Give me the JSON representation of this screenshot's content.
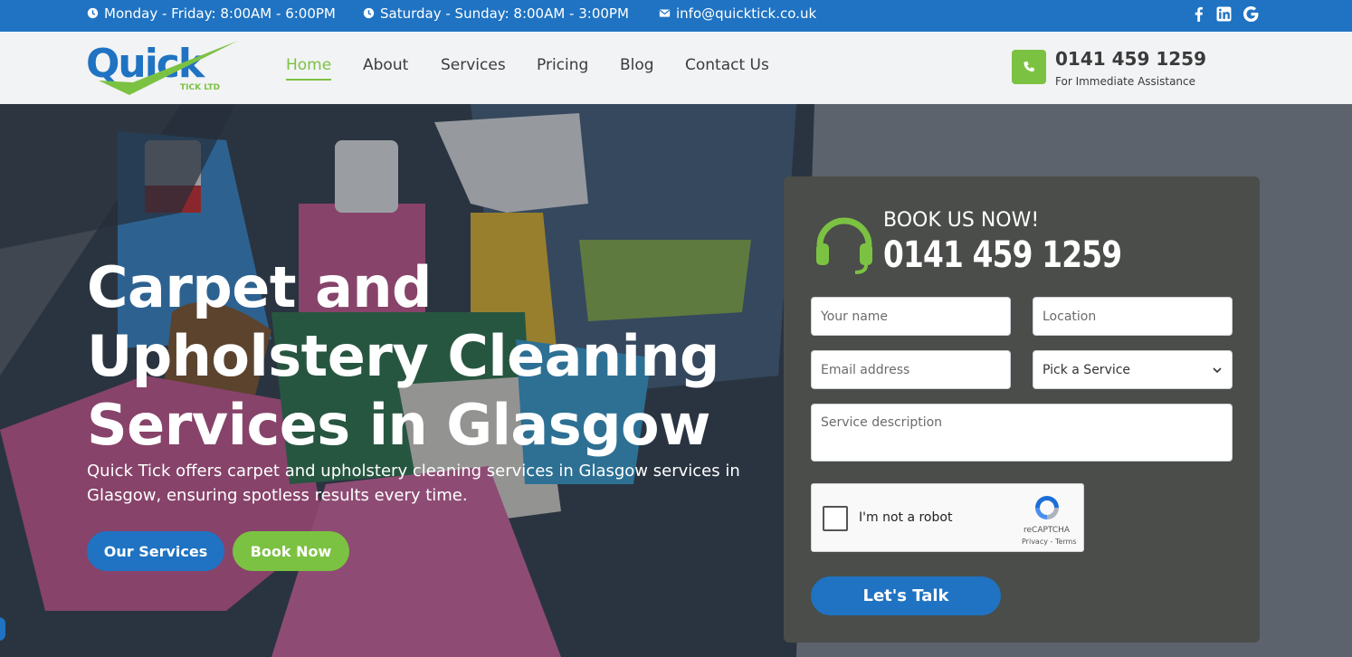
{
  "topbar": {
    "hours_weekday": "Monday - Friday: 8:00AM - 6:00PM",
    "hours_weekend": "Saturday - Sunday: 8:00AM - 3:00PM",
    "email": "info@quicktick.co.uk",
    "social_icons": [
      "facebook-icon",
      "linkedin-icon",
      "google-icon"
    ]
  },
  "header": {
    "logo_text": "Quick",
    "logo_sub": "TICK LTD",
    "nav": [
      {
        "label": "Home",
        "active": true
      },
      {
        "label": "About",
        "active": false
      },
      {
        "label": "Services",
        "active": false
      },
      {
        "label": "Pricing",
        "active": false
      },
      {
        "label": "Blog",
        "active": false
      },
      {
        "label": "Contact Us",
        "active": false
      }
    ],
    "phone": "0141 459 1259",
    "phone_sub": "For Immediate Assistance"
  },
  "hero": {
    "title": "Carpet and Upholstery Cleaning Services in Glasgow",
    "text": "Quick Tick offers carpet and upholstery cleaning services in Glasgow services in Glasgow, ensuring spotless results every time.",
    "btn_services": "Our Services",
    "btn_book": "Book Now"
  },
  "booking": {
    "label": "BOOK US NOW!",
    "phone": "0141 459 1259",
    "name_placeholder": "Your name",
    "location_placeholder": "Location",
    "email_placeholder": "Email address",
    "service_selected": "Pick a Service",
    "description_placeholder": "Service description",
    "captcha_text": "I'm not a robot",
    "captcha_brand": "reCAPTCHA",
    "captcha_terms": "Privacy - Terms",
    "submit_label": "Let's Talk"
  },
  "colors": {
    "brand_blue": "#1f73c2",
    "brand_green": "#7cc242",
    "panel_bg": "#4a4d49"
  }
}
